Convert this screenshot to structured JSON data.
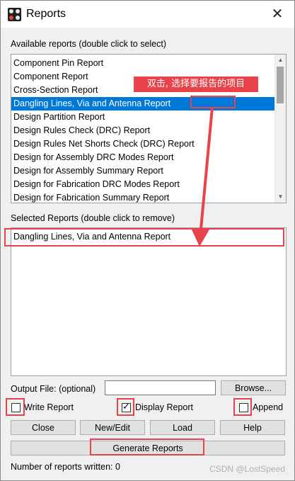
{
  "window": {
    "title": "Reports",
    "close_symbol": "✕",
    "app_icon": "app-logo-icon"
  },
  "available": {
    "label": "Available reports (double click to select)",
    "items": [
      {
        "label": "Component Pin Report",
        "selected": false
      },
      {
        "label": "Component Report",
        "selected": false
      },
      {
        "label": "Cross-Section Report",
        "selected": false
      },
      {
        "label": "Dangling Lines, Via and Antenna Report",
        "selected": true
      },
      {
        "label": "Design Partition Report",
        "selected": false
      },
      {
        "label": "Design Rules Check (DRC) Report",
        "selected": false
      },
      {
        "label": "Design Rules Net Shorts Check (DRC) Report",
        "selected": false
      },
      {
        "label": "Design for Assembly DRC Modes Report",
        "selected": false
      },
      {
        "label": "Design for Assembly Summary Report",
        "selected": false
      },
      {
        "label": "Design for Fabrication DRC Modes Report",
        "selected": false
      },
      {
        "label": "Design for Fabrication Summary Report",
        "selected": false
      }
    ]
  },
  "selected": {
    "label": "Selected Reports (double click to remove)",
    "items": [
      "Dangling Lines, Via and Antenna Report"
    ]
  },
  "output": {
    "label": "Output File: (optional)",
    "value": "",
    "browse_label": "Browse..."
  },
  "options": {
    "write_report": {
      "label": "Write Report",
      "checked": false
    },
    "display_report": {
      "label": "Display Report",
      "checked": true
    },
    "append": {
      "label": "Append",
      "checked": false
    }
  },
  "buttons": {
    "close": "Close",
    "new_edit": "New/Edit",
    "load": "Load",
    "help": "Help",
    "generate": "Generate Reports"
  },
  "status": {
    "reports_written": "Number of reports written: 0"
  },
  "annotation": {
    "text": "双击, 选择要报告的项目",
    "color": "#e8424a"
  },
  "watermark": "CSDN @LostSpeed",
  "colors": {
    "selection": "#0078d7",
    "highlight_red": "#e8424a"
  }
}
